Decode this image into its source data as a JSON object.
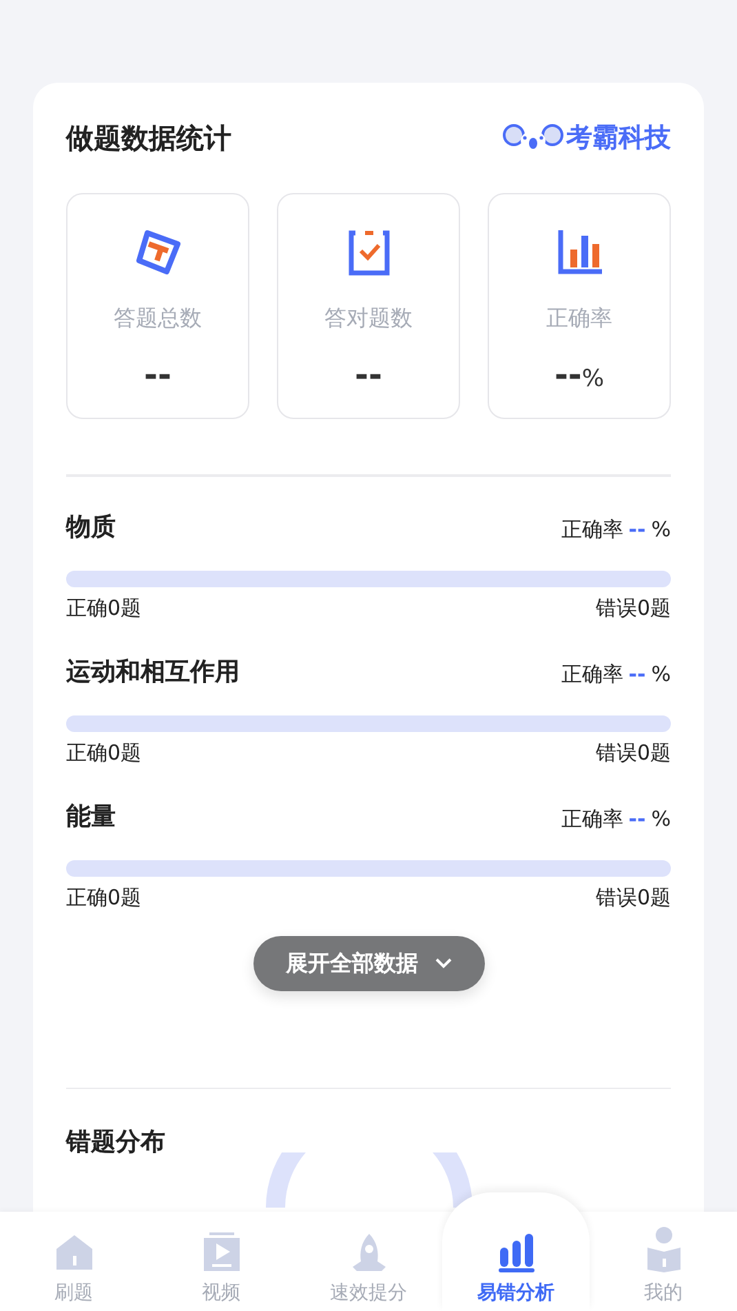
{
  "header": {
    "title": "做题数据统计",
    "brand": "考霸科技"
  },
  "stats": [
    {
      "kind": "total",
      "label": "答题总数",
      "value": "--"
    },
    {
      "kind": "correct",
      "label": "答对题数",
      "value": "--"
    },
    {
      "kind": "rate",
      "label": "正确率",
      "value": "--",
      "unit": "%"
    }
  ],
  "subjects": [
    {
      "name": "物质",
      "rate_label": "正确率",
      "rate": "--",
      "unit": "%",
      "level": 0,
      "correct": "正确0题",
      "wrong": "错误0题"
    },
    {
      "name": "运动和相互作用",
      "rate_label": "正确率",
      "rate": "--",
      "unit": "%",
      "level": 0,
      "correct": "正确0题",
      "wrong": "错误0题"
    },
    {
      "name": "能量",
      "rate_label": "正确率",
      "rate": "--",
      "unit": "%",
      "level": 0,
      "correct": "正确0题",
      "wrong": "错误0题"
    }
  ],
  "expand_button": {
    "label": "展开全部数据"
  },
  "distribution": {
    "title": "错题分布"
  },
  "tabs": [
    {
      "kind": "home",
      "label": "刷题",
      "selected": false
    },
    {
      "kind": "video",
      "label": "视频",
      "selected": false
    },
    {
      "kind": "rocket",
      "label": "速效提分",
      "selected": false
    },
    {
      "kind": "chart",
      "label": "易错分析",
      "selected": true
    },
    {
      "kind": "user",
      "label": "我的",
      "selected": false
    }
  ]
}
